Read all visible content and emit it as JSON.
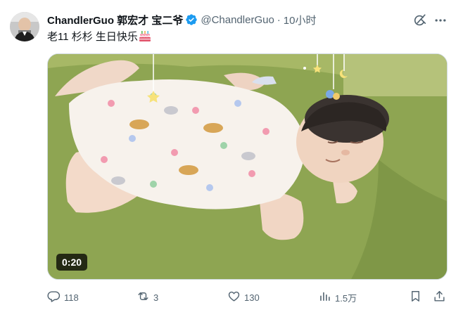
{
  "author": {
    "display_name": "ChandlerGuo 郭宏才 宝二爷",
    "handle": "@ChandlerGuo",
    "separator": "·",
    "time": "10小时",
    "verified": true
  },
  "tweet": {
    "text": "老11 杉杉 生日快乐",
    "emoji": "birthday-cake"
  },
  "media": {
    "type": "video",
    "duration": "0:20"
  },
  "actions": {
    "replies": "118",
    "retweets": "3",
    "likes": "130",
    "views": "1.5万"
  },
  "colors": {
    "text_primary": "#0f1419",
    "text_secondary": "#536471",
    "verified_blue": "#1d9bf0",
    "blanket_green": "#8aa14d"
  },
  "icons": [
    "grok-icon",
    "more-icon",
    "reply-icon",
    "retweet-icon",
    "like-icon",
    "views-icon",
    "bookmark-icon",
    "share-icon"
  ]
}
